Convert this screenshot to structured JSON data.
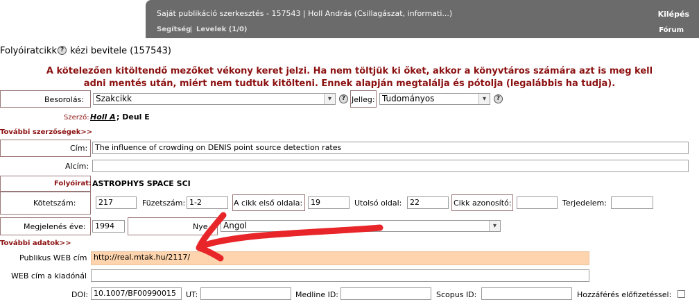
{
  "topbar": {
    "title": "Saját publikáció szerkesztés - 157543 | Holl András (Csillagászat, informati...)",
    "logout": "Kilépés",
    "help": "Segítség",
    "separator": "|",
    "letters": "Levelek (1/0)",
    "forum": "Fórum"
  },
  "page": {
    "title_a": "Folyóiratcikk",
    "title_b": " kézi bevitele (157543)",
    "warning_line1": "A kötelezően kitöltendő mezőket vékony keret jelzi. Ha nem töltjük ki őket, akkor a könyvtáros számára azt is meg kell",
    "warning_line2": "adni mentés után, miért nem tudtuk kitölteni. Ennek alapján megtalálja és pótolja (legalábbis ha tudja)."
  },
  "help_icon": "?",
  "form": {
    "besorolas_label": "Besorolás:",
    "besorolas_value": "Szakcikk",
    "jelleg_label": "Jelleg:",
    "jelleg_value": "Tudományos",
    "szerzo_label": "Szerző:",
    "szerzo_main": "Holl A",
    "szerzo_rest": "; Deul E",
    "tovabbi_szerzosegek": "További szerzőségek>>",
    "cim_label": "Cím:",
    "cim_value": "The influence of crowding on DENIS point source detection rates",
    "alcim_label": "Alcím:",
    "alcim_value": "",
    "folyoirat_label": "Folyóirat:",
    "folyoirat_value": "ASTROPHYS SPACE SCI",
    "kotetszam_label": "Kötetszám:",
    "kotetszam_value": "217",
    "fuzetszam_label": "Füzetszám:",
    "fuzetszam_value": "1-2",
    "elso_oldal_label": "A cikk első oldala:",
    "elso_oldal_value": "19",
    "utolso_oldal_label": "Utolsó oldal:",
    "utolso_oldal_value": "22",
    "cikk_azonosito_label": "Cikk azonosító:",
    "cikk_azonosito_value": "",
    "terjedelem_label": "Terjedelem:",
    "terjedelem_value": "",
    "megjelenes_label": "Megjelenés éve:",
    "megjelenes_value": "1994",
    "nyelv_label": "Nye",
    "nyelv_value": "Angol",
    "tovabbi_adatok": "További adatok>>",
    "publikus_web_label": "Publikus WEB cím",
    "publikus_web_value": "http://real.mtak.hu/2117/",
    "web_kiado_label": "WEB cím a kiadónál",
    "web_kiado_value": "",
    "doi_label": "DOI:",
    "doi_value": "10.1007/BF00990015",
    "ut_label": "UT:",
    "ut_value": "",
    "medline_label": "Medline ID:",
    "medline_value": "",
    "scopus_label": "Scopus ID:",
    "scopus_value": "",
    "hozzaferes_label": "Hozzáférés előfizetéssel:"
  },
  "annotation_color": "#e8262a"
}
